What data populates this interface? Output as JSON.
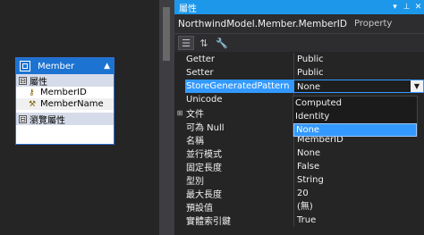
{
  "entity": {
    "name": "Member",
    "collapse_glyph": "▲",
    "properties_section": "屬性",
    "properties": [
      {
        "name": "MemberID",
        "icon": "key-icon"
      },
      {
        "name": "MemberName",
        "icon": "wrench-icon"
      }
    ],
    "navigation_section": "瀏覽屬性",
    "section_toggle": "⊟"
  },
  "panel": {
    "title": "屬性",
    "pin_glyph": "▾",
    "pushpin_glyph": "⊥",
    "close_glyph": "✕",
    "object_name": "NorthwindModel.Member.MemberID",
    "object_type": "Property"
  },
  "toolbar": {
    "categorized_glyph": "☰",
    "alphabetical_glyph": "⇅",
    "property_pages_glyph": "🔧"
  },
  "grid": {
    "rows": [
      {
        "name": "Getter",
        "value": "Public"
      },
      {
        "name": "Setter",
        "value": "Public"
      },
      {
        "name": "StoreGeneratedPattern",
        "value": "None",
        "selected": true
      },
      {
        "name": "Unicode",
        "value": ""
      },
      {
        "name": "文件",
        "value": "",
        "expander": "⊞"
      },
      {
        "name": "可為 Null",
        "value": ""
      },
      {
        "name": "名稱",
        "value": "MemberID"
      },
      {
        "name": "並行模式",
        "value": "None"
      },
      {
        "name": "固定長度",
        "value": "False"
      },
      {
        "name": "型別",
        "value": "String"
      },
      {
        "name": "最大長度",
        "value": "20"
      },
      {
        "name": "預設值",
        "value": "(無)"
      },
      {
        "name": "實體索引鍵",
        "value": "True"
      }
    ],
    "dropdown_arrow": "▼"
  },
  "dropdown": {
    "options": [
      "Computed",
      "Identity",
      "None"
    ],
    "selected": "None"
  }
}
